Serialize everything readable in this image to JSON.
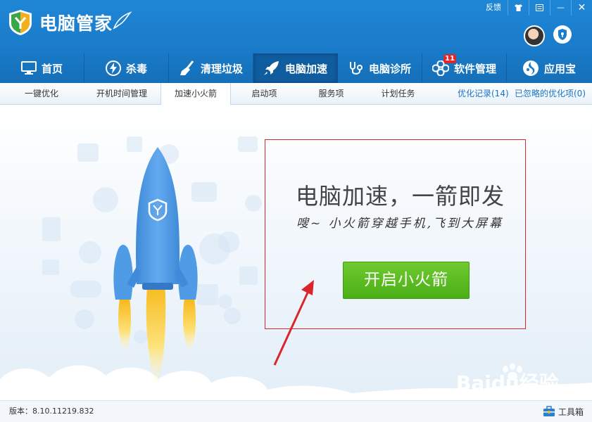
{
  "app": {
    "title": "电脑管家"
  },
  "window_controls": {
    "feedback": "反馈",
    "skin_icon": "tshirt-icon",
    "menu_icon": "menu-icon",
    "minimize": "—",
    "close": "✕"
  },
  "main_nav": [
    {
      "label": "首页",
      "icon": "monitor-icon",
      "active": false
    },
    {
      "label": "杀毒",
      "icon": "lightning-icon",
      "active": false
    },
    {
      "label": "清理垃圾",
      "icon": "broom-icon",
      "active": false
    },
    {
      "label": "电脑加速",
      "icon": "rocket-icon",
      "active": true
    },
    {
      "label": "电脑诊所",
      "icon": "stethoscope-icon",
      "active": false
    },
    {
      "label": "软件管理",
      "icon": "clover-icon",
      "active": false,
      "badge": "11"
    },
    {
      "label": "应用宝",
      "icon": "app-store-icon",
      "active": false
    }
  ],
  "sub_nav": {
    "tabs": [
      {
        "label": "一键优化"
      },
      {
        "label": "开机时间管理"
      },
      {
        "label": "加速小火箭",
        "active": true
      },
      {
        "label": "启动项"
      },
      {
        "label": "服务项"
      },
      {
        "label": "计划任务"
      }
    ],
    "links": [
      {
        "label": "优化记录(14)"
      },
      {
        "label": "已忽略的优化项(0)"
      }
    ]
  },
  "hero": {
    "headline": "电脑加速，一箭即发",
    "tagline": "嗖~ 小火箭穿越手机,飞到大屏幕",
    "button_label": "开启小火箭"
  },
  "watermark": {
    "text": "Baidu经验",
    "url": "jingyan.baidu.com"
  },
  "footer": {
    "version": "版本：8.10.11219.832",
    "toolbox_label": "工具箱"
  },
  "colors": {
    "header_blue": "#1a7cca",
    "active_tab": "#0f5c9f",
    "button_green": "#52b41d",
    "highlight_red": "#d9262c",
    "rocket_blue": "#4f9be6"
  }
}
